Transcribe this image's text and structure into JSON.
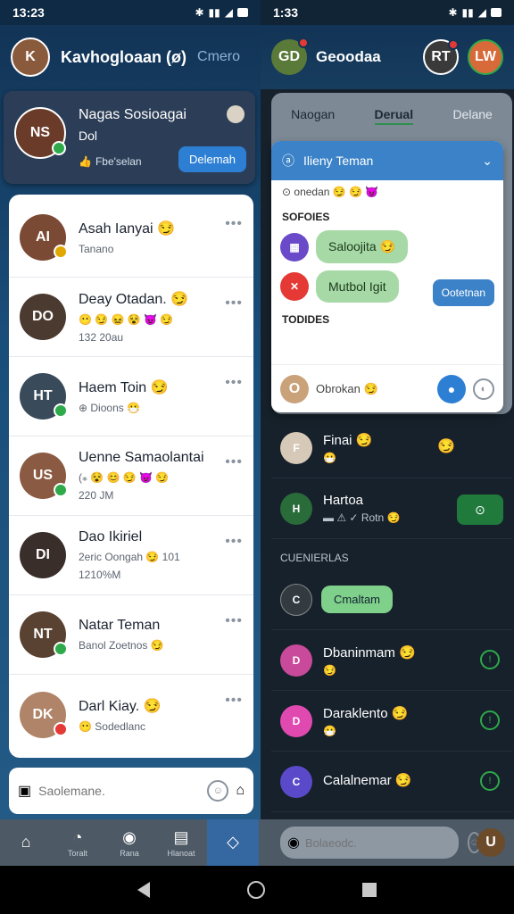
{
  "status_left": {
    "time": "13:23"
  },
  "status_right": {
    "time": "1:33"
  },
  "colors": {
    "accent": "#2d7fd4",
    "online": "#2eaa4a",
    "bubble": "#a7d9a7",
    "dark_bg": "#16212b"
  },
  "left_header": {
    "title": "Kavhogloaan (ø)",
    "ghost_title": "Cmero"
  },
  "profile": {
    "name": "Nagas Sosioagai",
    "subtitle": "Dol",
    "meta": "Fbe'selan",
    "button": "Delemah",
    "avatar_initials": "NS"
  },
  "chats": [
    {
      "name": "Asah Ianyai 😏",
      "sub": "Tanano",
      "initials": "AI",
      "color": "#7a4a34",
      "online": true,
      "online_color": "#e0a800"
    },
    {
      "name": "Deay Otadan. 😏",
      "sub": "😶 😏 😖 😵 😈 😏",
      "sub2": "132 20au",
      "initials": "DO",
      "color": "#4b3a2f",
      "online": false
    },
    {
      "name": "Haem Toin 😏",
      "sub": "⊕ Dioons 😷",
      "initials": "HT",
      "color": "#394a5a",
      "online": true
    },
    {
      "name": "Uenne Samaolantai",
      "sub": "(⁎ 😵 😊 😏 😈 😏",
      "sub2": "220 JM",
      "initials": "US",
      "color": "#8a5a42",
      "online": true
    },
    {
      "name": "Dao Ikiriel",
      "sub": "2eric Oongah 😏 101",
      "sub2": "1210%M",
      "initials": "DI",
      "color": "#3a2e2a",
      "online": false
    },
    {
      "name": "Natar Teman",
      "sub": "Banol Zoetnos 😏",
      "initials": "NT",
      "color": "#5a4232",
      "online": true
    },
    {
      "name": "Darl Kiay. 😏",
      "sub": "😶 Sodedlanc",
      "initials": "DK",
      "color": "#b08468",
      "online": true,
      "online_color": "#e53935"
    }
  ],
  "left_search": {
    "placeholder": "Saolemane."
  },
  "right_header": {
    "title": "Geoodaa",
    "avatar1": "GD",
    "avatar2": "RT",
    "avatar3": "LW"
  },
  "tabs": [
    {
      "label": "Naogan"
    },
    {
      "label": "Derual"
    },
    {
      "label": "Delane"
    }
  ],
  "popup": {
    "title": "Ilieny Teman",
    "line1": "⊙ onedan 😏 😏 😈",
    "section1": "SOFOIES",
    "bubble1": "Saloojita 😏",
    "bubble2": "Mutbol Igit",
    "bubble_button": "Ootetnan",
    "section2": "TODIDES",
    "footer_text": "Obrokan 😏"
  },
  "dark_items": [
    {
      "name": "Finai 😏",
      "trail": "😏",
      "sub": "😷",
      "initials": "F",
      "color": "#d7c9b8"
    },
    {
      "name": "Hartoa",
      "sub": "▬ ⚠ ✓ Rotn 😏",
      "initials": "H",
      "color": "#2a6b3a",
      "button": "⊙"
    },
    {
      "section": "CUENIERLAS"
    },
    {
      "chip": "Cmaltam",
      "initials": "C",
      "color": "#333a40"
    },
    {
      "name": "Dbaninmam 😏",
      "sub": "😏",
      "initials": "D",
      "color": "#c94a9a"
    },
    {
      "name": "Daraklento 😏",
      "sub": "😷",
      "initials": "D",
      "color": "#e04ab0"
    },
    {
      "name": "Calalnemar 😏",
      "sub": "",
      "initials": "C",
      "color": "#5a4ac9"
    }
  ],
  "bottom_nav": [
    {
      "label": "",
      "glyph": "⌂",
      "active": false
    },
    {
      "label": "Toralt",
      "glyph": "◔",
      "active": false
    },
    {
      "label": "Rana",
      "glyph": "◉",
      "active": false
    },
    {
      "label": "Hlanoat",
      "glyph": "▤",
      "active": false
    },
    {
      "label": "",
      "glyph": "◇",
      "active": true
    }
  ],
  "bottom_search": {
    "placeholder": "Bolaeodc."
  }
}
